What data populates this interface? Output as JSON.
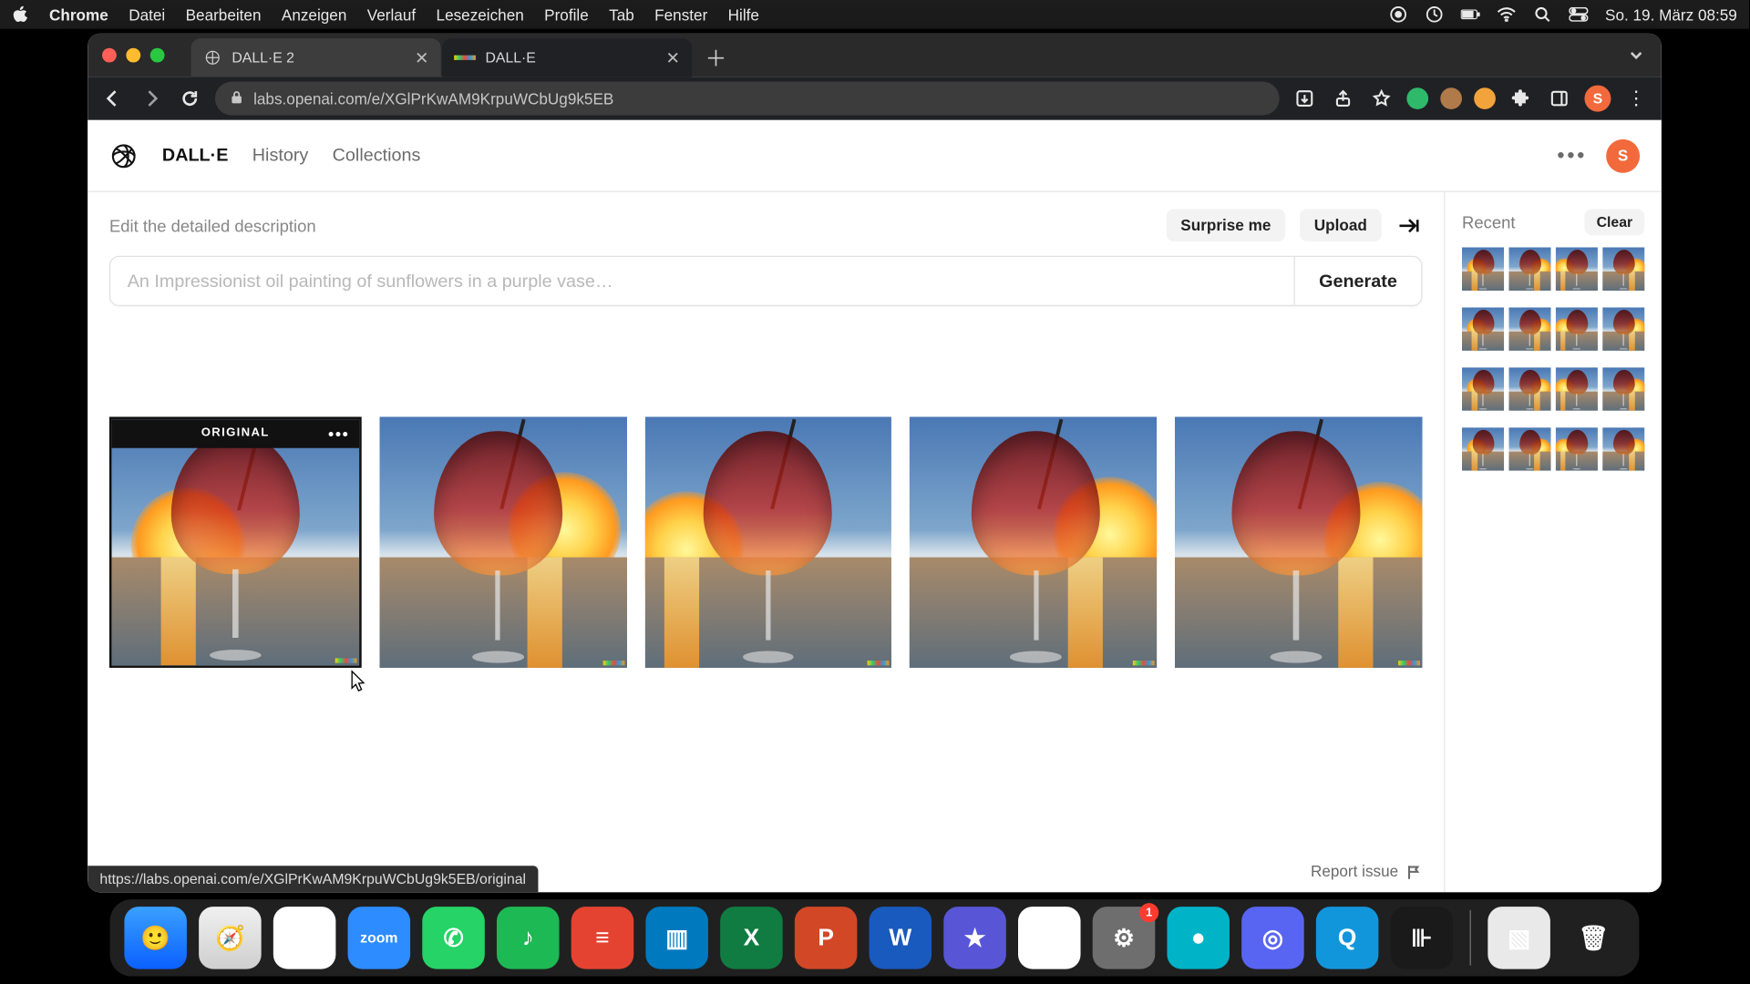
{
  "menubar": {
    "app": "Chrome",
    "items": [
      "Datei",
      "Bearbeiten",
      "Anzeigen",
      "Verlauf",
      "Lesezeichen",
      "Profile",
      "Tab",
      "Fenster",
      "Hilfe"
    ],
    "clock": "So. 19. März  08:59"
  },
  "browser": {
    "tabs": [
      {
        "title": "DALL·E 2",
        "active": false
      },
      {
        "title": "DALL·E",
        "active": true
      }
    ],
    "url": "labs.openai.com/e/XGlPrKwAM9KrpuWCbUg9k5EB",
    "avatar_initial": "S"
  },
  "app": {
    "brand": "DALL·E",
    "nav": {
      "dalle": "DALL·E",
      "history": "History",
      "collections": "Collections"
    },
    "user_initial": "S",
    "prompt_label": "Edit the detailed description",
    "surprise": "Surprise me",
    "upload": "Upload",
    "placeholder": "An Impressionist oil painting of sunflowers in a purple vase…",
    "generate": "Generate",
    "original_badge": "ORIGINAL",
    "report": "Report issue",
    "side_title": "Recent",
    "clear": "Clear"
  },
  "status_url": "https://labs.openai.com/e/XGlPrKwAM9KrpuWCbUg9k5EB/original",
  "results": [
    {
      "sun_left": "8%",
      "sun_top": "28%",
      "reflect_left": "20%",
      "glass_shift": "-50%"
    },
    {
      "sun_left": "52%",
      "sun_top": "22%",
      "reflect_left": "60%",
      "glass_shift": "-54%"
    },
    {
      "sun_left": "-6%",
      "sun_top": "30%",
      "reflect_left": "8%",
      "glass_shift": "-50%"
    },
    {
      "sun_left": "58%",
      "sun_top": "24%",
      "reflect_left": "64%",
      "glass_shift": "-48%"
    },
    {
      "sun_left": "60%",
      "sun_top": "26%",
      "reflect_left": "66%",
      "glass_shift": "-52%"
    }
  ],
  "recent_rows": 4,
  "dock": {
    "apps": [
      {
        "name": "finder",
        "bg": "linear-gradient(#3aa0ff,#0a60ff)",
        "glyph": "🙂"
      },
      {
        "name": "safari",
        "bg": "linear-gradient(#f0f0f0,#cfcfcf)",
        "glyph": "🧭"
      },
      {
        "name": "chrome",
        "bg": "#fff",
        "glyph": "◉"
      },
      {
        "name": "zoom",
        "bg": "#2d8cff",
        "glyph": "zoom",
        "fs": "12px"
      },
      {
        "name": "whatsapp",
        "bg": "#25d366",
        "glyph": "✆"
      },
      {
        "name": "spotify",
        "bg": "#1db954",
        "glyph": "♪"
      },
      {
        "name": "todoist",
        "bg": "#e44332",
        "glyph": "≡"
      },
      {
        "name": "trello",
        "bg": "#0079bf",
        "glyph": "▥"
      },
      {
        "name": "excel",
        "bg": "#107c41",
        "glyph": "X"
      },
      {
        "name": "powerpoint",
        "bg": "#d24726",
        "glyph": "P"
      },
      {
        "name": "word",
        "bg": "#185abd",
        "glyph": "W"
      },
      {
        "name": "imovie",
        "bg": "#5856d6",
        "glyph": "★"
      },
      {
        "name": "drive",
        "bg": "#fff",
        "glyph": "△"
      },
      {
        "name": "settings",
        "bg": "#6e6e6e",
        "glyph": "⚙",
        "badge": "1"
      },
      {
        "name": "app-teal",
        "bg": "#00b3c7",
        "glyph": "●"
      },
      {
        "name": "discord",
        "bg": "#5865f2",
        "glyph": "◎"
      },
      {
        "name": "quicktime",
        "bg": "#1296db",
        "glyph": "Q"
      },
      {
        "name": "voice-memos",
        "bg": "#1a1a1a",
        "glyph": "⊪"
      }
    ],
    "right": [
      {
        "name": "preview",
        "bg": "#e9e9e9",
        "glyph": "▧"
      },
      {
        "name": "trash",
        "bg": "transparent",
        "glyph": "🗑"
      }
    ]
  }
}
